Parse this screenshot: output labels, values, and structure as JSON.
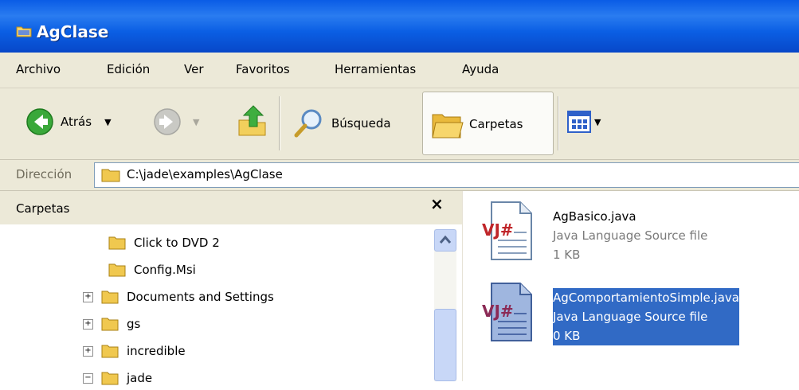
{
  "window": {
    "title": "AgClase"
  },
  "menu": [
    "Archivo",
    "Edición",
    "Ver",
    "Favoritos",
    "Herramientas",
    "Ayuda"
  ],
  "toolbar": {
    "back_label": "Atrás",
    "search_label": "Búsqueda",
    "folders_label": "Carpetas"
  },
  "address": {
    "label": "Dirección",
    "path": "C:\\jade\\examples\\AgClase"
  },
  "folders_pane": {
    "title": "Carpetas",
    "close": "×",
    "items": [
      {
        "label": "Click to DVD 2",
        "expander": ""
      },
      {
        "label": "Config.Msi",
        "expander": ""
      },
      {
        "label": "Documents and Settings",
        "expander": "+"
      },
      {
        "label": "gs",
        "expander": "+"
      },
      {
        "label": "incredible",
        "expander": "+"
      },
      {
        "label": "jade",
        "expander": "−"
      }
    ]
  },
  "files": [
    {
      "name": "AgBasico.java",
      "type": "Java Language Source file",
      "size": "1 KB",
      "selected": false
    },
    {
      "name": "AgComportamientoSimple.java",
      "type": "Java Language Source file",
      "size": "0 KB",
      "selected": true
    }
  ],
  "colors": {
    "titlebar": "#0b5fe4",
    "selection": "#316ac5",
    "chrome": "#ece9d8"
  }
}
